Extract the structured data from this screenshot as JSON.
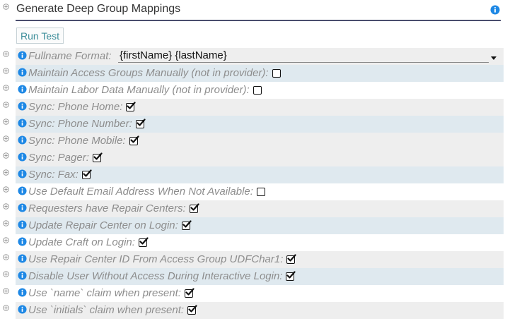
{
  "header": {
    "title": "Generate Deep Group Mappings",
    "run_test_label": "Run Test"
  },
  "fullname": {
    "label": "Fullname Format:",
    "value": "{firstName} {lastName}"
  },
  "settings": [
    {
      "label": "Maintain Access Groups Manually (not in provider):",
      "checked": false
    },
    {
      "label": "Maintain Labor Data Manually (not in provider):",
      "checked": false
    },
    {
      "label": "Sync: Phone Home:",
      "checked": true
    },
    {
      "label": "Sync: Phone Number:",
      "checked": true
    },
    {
      "label": "Sync: Phone Mobile:",
      "checked": true
    },
    {
      "label": "Sync: Pager:",
      "checked": true
    },
    {
      "label": "Sync: Fax:",
      "checked": true
    },
    {
      "label": "Use Default Email Address When Not Available:",
      "checked": false
    },
    {
      "label": "Requesters have Repair Centers:",
      "checked": true
    },
    {
      "label": "Update Repair Center on Login:",
      "checked": true
    },
    {
      "label": "Update Craft on Login:",
      "checked": true
    },
    {
      "label": "Use Repair Center ID From Access Group UDFChar1:",
      "checked": true
    },
    {
      "label": "Disable User Without Access During Interactive Login:",
      "checked": true
    },
    {
      "label": "Use `name` claim when present:",
      "checked": true
    },
    {
      "label": "Use `initials` claim when present:",
      "checked": true
    }
  ],
  "colors": {
    "row_alt": "#dfe9ef",
    "row_gray": "#eeeeee",
    "info_icon": "#1e88e5",
    "header_line": "#4a4e6e",
    "run_test_text": "#3d8e9a"
  },
  "icons": {
    "expander": "collapse-toggle-icon",
    "info": "info-icon",
    "dropdown": "chevron-down-icon"
  }
}
